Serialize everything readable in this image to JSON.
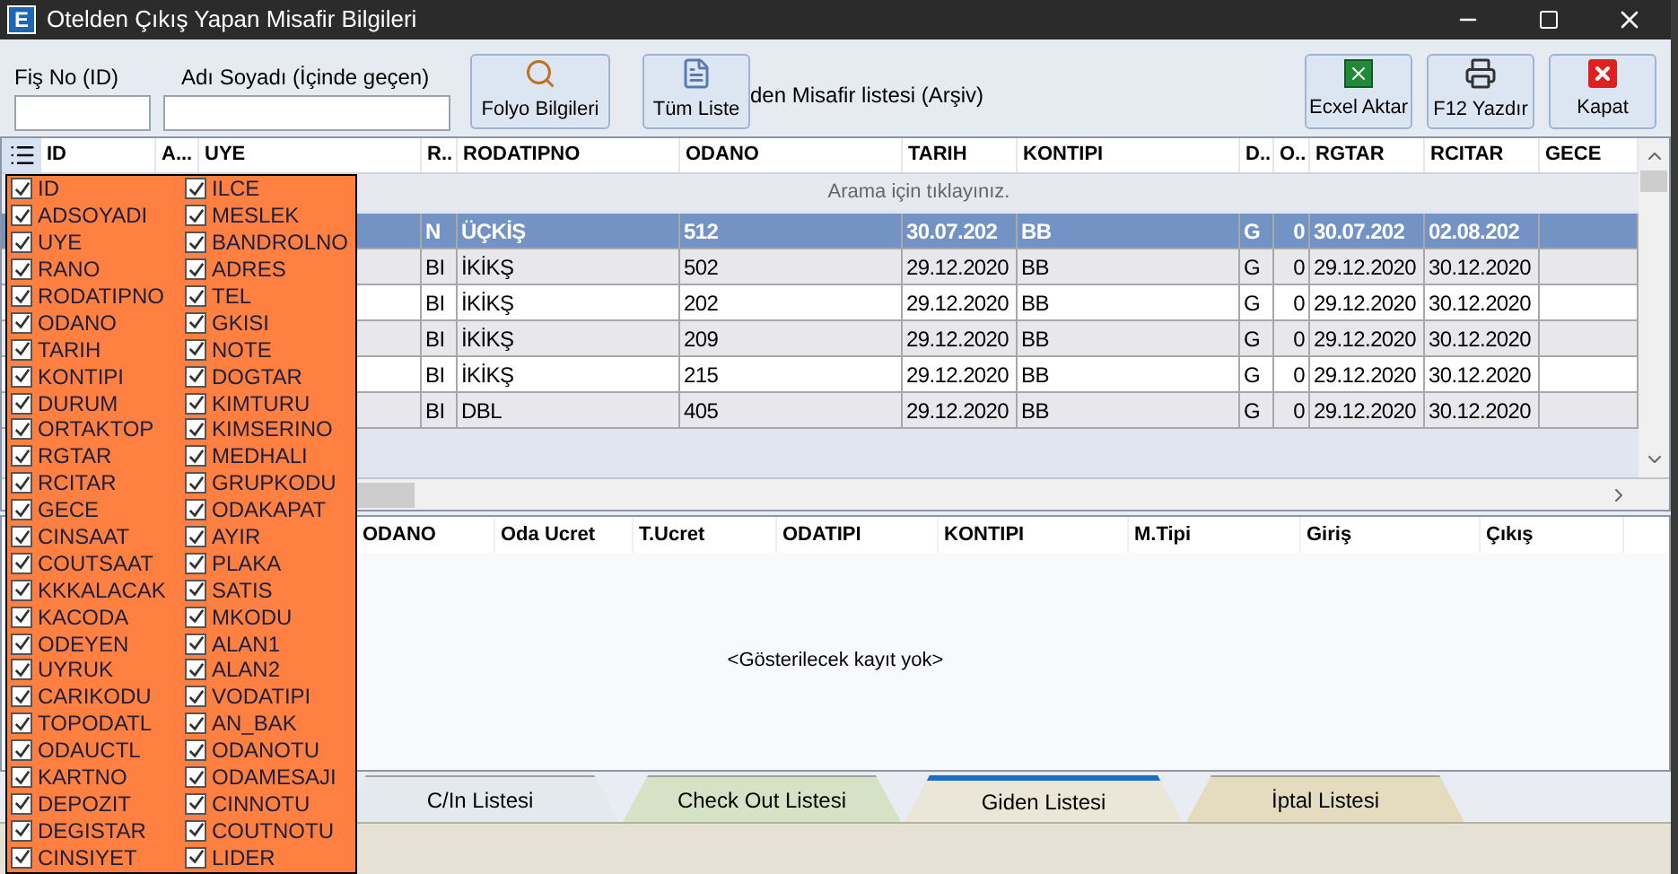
{
  "window": {
    "icon_letter": "E",
    "title": "Otelden Çıkış Yapan Misafir Bilgileri"
  },
  "filters": [
    {
      "label": "Fiş No (ID)"
    },
    {
      "label": "Adı Soyadı (İçinde geçen)"
    }
  ],
  "toolbar_left": [
    {
      "kind": "search",
      "label": "Folyo Bilgileri"
    },
    {
      "kind": "list",
      "label": "Tüm Liste"
    }
  ],
  "archive_option": {
    "label": "den Misafir listesi (Arşiv)"
  },
  "toolbar_right": [
    {
      "kind": "excel",
      "label": "Ecxel Aktar"
    },
    {
      "kind": "print",
      "label": "F12 Yazdır"
    },
    {
      "kind": "close",
      "label": "Kapat"
    }
  ],
  "grid": {
    "columns": [
      "ID",
      "A...",
      "UYE",
      "R..",
      "RODATIPNO",
      "ODANO",
      "TARIH",
      "KONTIPI",
      "D..",
      "O..",
      "RGTAR",
      "RCITAR",
      "GECE"
    ],
    "search_hint": "Arama için tıklayınız.",
    "rows": [
      {
        "selected": true,
        "cells": [
          "",
          "",
          "",
          "N",
          "ÜÇKİŞ",
          "512",
          "30.07.202",
          "BB",
          "G",
          "0",
          "30.07.202",
          "02.08.202"
        ]
      },
      {
        "selected": false,
        "cells": [
          "",
          "",
          "",
          "BI",
          "İKİKŞ",
          "502",
          "29.12.2020",
          "BB",
          "G",
          "0",
          "29.12.2020",
          "30.12.2020"
        ]
      },
      {
        "selected": false,
        "cells": [
          "",
          "",
          "",
          "BI",
          "İKİKŞ",
          "202",
          "29.12.2020",
          "BB",
          "G",
          "0",
          "29.12.2020",
          "30.12.2020"
        ]
      },
      {
        "selected": false,
        "cells": [
          "",
          "",
          "",
          "BI",
          "İKİKŞ",
          "209",
          "29.12.2020",
          "BB",
          "G",
          "0",
          "29.12.2020",
          "30.12.2020"
        ]
      },
      {
        "selected": false,
        "cells": [
          "",
          "",
          "",
          "BI",
          "İKİKŞ",
          "215",
          "29.12.2020",
          "BB",
          "G",
          "0",
          "29.12.2020",
          "30.12.2020"
        ]
      },
      {
        "selected": false,
        "cells": [
          "",
          "",
          "",
          "BI",
          "DBL",
          "405",
          "29.12.2020",
          "BB",
          "G",
          "0",
          "29.12.2020",
          "30.12.2020"
        ]
      }
    ]
  },
  "column_chooser": [
    {
      "label": "ID",
      "checked": true
    },
    {
      "label": "ILCE",
      "checked": true
    },
    {
      "label": "ADSOYADI",
      "checked": true
    },
    {
      "label": "MESLEK",
      "checked": true
    },
    {
      "label": "UYE",
      "checked": true
    },
    {
      "label": "BANDROLNO",
      "checked": true
    },
    {
      "label": "RANO",
      "checked": true
    },
    {
      "label": "ADRES",
      "checked": true
    },
    {
      "label": "RODATIPNO",
      "checked": true
    },
    {
      "label": "TEL",
      "checked": true
    },
    {
      "label": "ODANO",
      "checked": true
    },
    {
      "label": "GKISI",
      "checked": true
    },
    {
      "label": "TARIH",
      "checked": true
    },
    {
      "label": "NOTE",
      "checked": true
    },
    {
      "label": "KONTIPI",
      "checked": true
    },
    {
      "label": "DOGTAR",
      "checked": true
    },
    {
      "label": "DURUM",
      "checked": true
    },
    {
      "label": "KIMTURU",
      "checked": true
    },
    {
      "label": "ORTAKTOP",
      "checked": true
    },
    {
      "label": "KIMSERINO",
      "checked": true
    },
    {
      "label": "RGTAR",
      "checked": true
    },
    {
      "label": "MEDHALI",
      "checked": true
    },
    {
      "label": "RCITAR",
      "checked": true
    },
    {
      "label": "GRUPKODU",
      "checked": true
    },
    {
      "label": "GECE",
      "checked": true
    },
    {
      "label": "ODAKAPAT",
      "checked": true
    },
    {
      "label": "CINSAAT",
      "checked": true
    },
    {
      "label": "AYIR",
      "checked": true
    },
    {
      "label": "COUTSAAT",
      "checked": true
    },
    {
      "label": "PLAKA",
      "checked": true
    },
    {
      "label": "KKKALACAK",
      "checked": true
    },
    {
      "label": "SATIS",
      "checked": true
    },
    {
      "label": "KACODA",
      "checked": true
    },
    {
      "label": "MKODU",
      "checked": true
    },
    {
      "label": "ODEYEN",
      "checked": true
    },
    {
      "label": "ALAN1",
      "checked": true
    },
    {
      "label": "UYRUK",
      "checked": true
    },
    {
      "label": "ALAN2",
      "checked": true
    },
    {
      "label": "CARIKODU",
      "checked": true
    },
    {
      "label": "VODATIPI",
      "checked": true
    },
    {
      "label": "TOPODATL",
      "checked": true
    },
    {
      "label": "AN_BAK",
      "checked": true
    },
    {
      "label": "ODAUCTL",
      "checked": true
    },
    {
      "label": "ODANOTU",
      "checked": true
    },
    {
      "label": "KARTNO",
      "checked": true
    },
    {
      "label": "ODAMESAJI",
      "checked": true
    },
    {
      "label": "DEPOZIT",
      "checked": true
    },
    {
      "label": "CINNOTU",
      "checked": true
    },
    {
      "label": "DEGISTAR",
      "checked": true
    },
    {
      "label": "COUTNOTU",
      "checked": true
    },
    {
      "label": "CINSIYET",
      "checked": true
    },
    {
      "label": "LIDER",
      "checked": true
    }
  ],
  "detail_grid": {
    "columns": [
      "ODANO",
      "Oda Ucret",
      "T.Ucret",
      "ODATIPI",
      "KONTIPI",
      "M.Tipi",
      "Giriş",
      "Çıkış"
    ],
    "empty_text": "<Gösterilecek kayıt yok>"
  },
  "tabs": [
    {
      "label": "C/In Listesi",
      "selected": false,
      "color": "#e4e8ef"
    },
    {
      "label": "Check Out Listesi",
      "selected": false,
      "color": "#d5e2c5"
    },
    {
      "label": "Giden Listesi",
      "selected": true,
      "color": "#ece6d8"
    },
    {
      "label": "İptal Listesi",
      "selected": false,
      "color": "#e5dcc0"
    }
  ]
}
